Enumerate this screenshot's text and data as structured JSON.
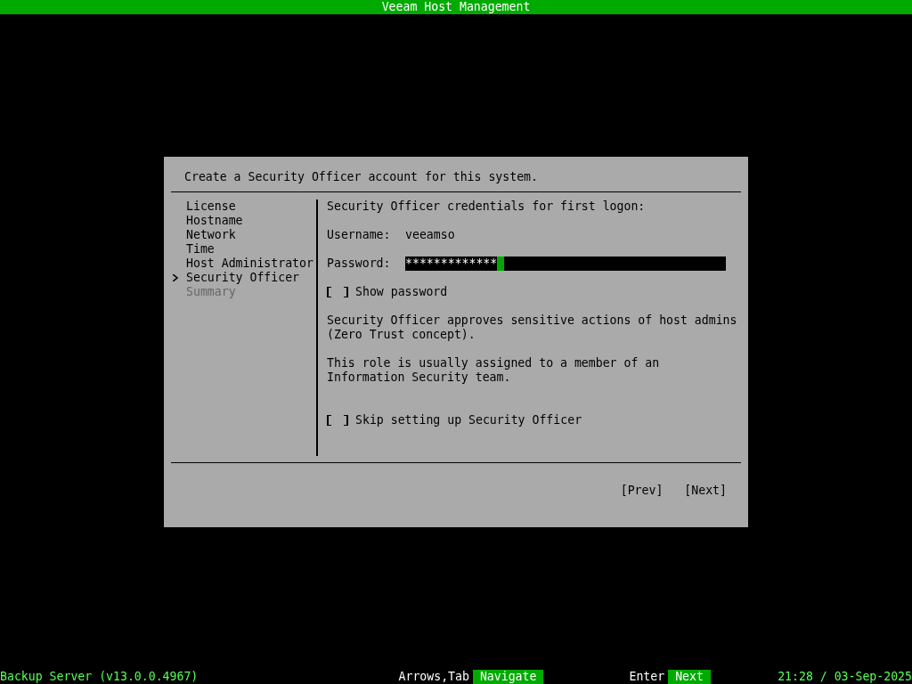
{
  "title_bar": {
    "title": "Veeam Host Management"
  },
  "dialog": {
    "header": "Create a Security Officer account for this system.",
    "steps": [
      {
        "label": "License",
        "selected": false,
        "disabled": false
      },
      {
        "label": "Hostname",
        "selected": false,
        "disabled": false
      },
      {
        "label": "Network",
        "selected": false,
        "disabled": false
      },
      {
        "label": "Time",
        "selected": false,
        "disabled": false
      },
      {
        "label": "Host Administrator",
        "selected": false,
        "disabled": false
      },
      {
        "label": "Security Officer",
        "selected": true,
        "disabled": false
      },
      {
        "label": "Summary",
        "selected": false,
        "disabled": true
      }
    ],
    "section_title": "Security Officer credentials for first logon:",
    "username": {
      "label": "Username:",
      "value": "veeamso"
    },
    "password": {
      "label": "Password:",
      "value": "*************"
    },
    "show_password": {
      "label": "Show password",
      "checked": false
    },
    "paragraphs": [
      "Security Officer approves sensitive actions of host admins (Zero Trust concept).",
      "This role is usually assigned to a member of an Information Security team."
    ],
    "skip": {
      "label": "Skip setting up Security Officer",
      "checked": false
    },
    "buttons": [
      "[Prev]",
      "[Next]"
    ]
  },
  "status_bar": {
    "server": "Backup Server (v13.0.0.4967)",
    "hints": [
      {
        "key": "Arrows,Tab",
        "action": "Navigate"
      },
      {
        "key": "Enter",
        "action": "Next"
      }
    ],
    "datetime": "21:28 / 03-Sep-2025"
  }
}
